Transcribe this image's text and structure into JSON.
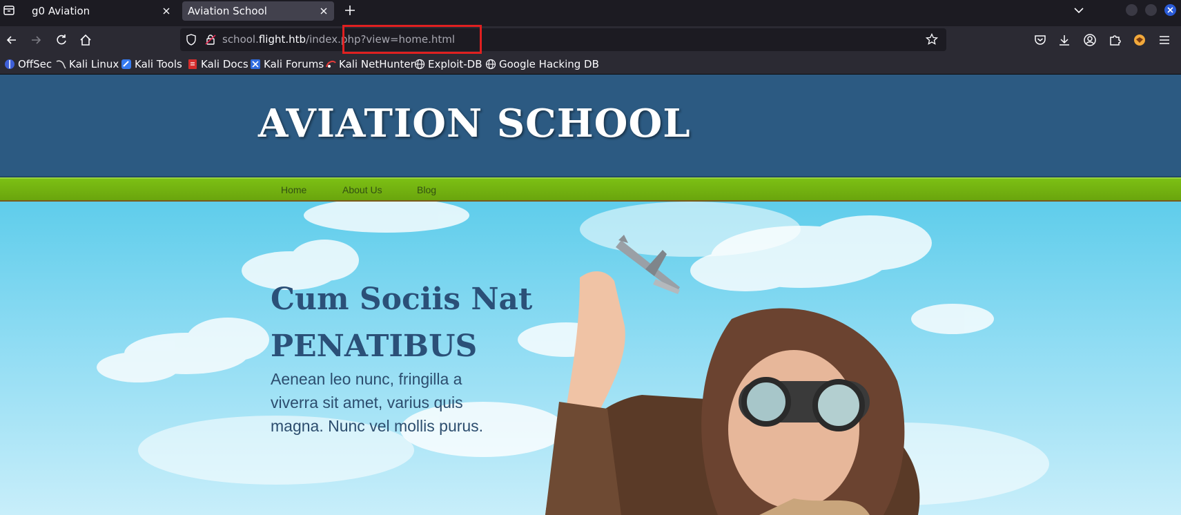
{
  "browser": {
    "tabs": [
      {
        "title": "g0 Aviation"
      },
      {
        "title": "Aviation School"
      }
    ],
    "url": {
      "host_prefix": "school.",
      "host_domain": "flight.htb",
      "path": "/index.php?view=home.html"
    },
    "bookmarks": [
      {
        "label": "OffSec",
        "icon": "offsec-icon"
      },
      {
        "label": "Kali Linux",
        "icon": "kali-dragon-icon"
      },
      {
        "label": "Kali Tools",
        "icon": "kali-tools-icon"
      },
      {
        "label": "Kali Docs",
        "icon": "kali-docs-icon"
      },
      {
        "label": "Kali Forums",
        "icon": "kali-forums-icon"
      },
      {
        "label": "Kali NetHunter",
        "icon": "nethunter-icon"
      },
      {
        "label": "Exploit-DB",
        "icon": "globe-icon"
      },
      {
        "label": "Google Hacking DB",
        "icon": "globe-icon"
      }
    ]
  },
  "site": {
    "title": "AVIATION SCHOOL",
    "nav": [
      "Home",
      "About Us",
      "Blog"
    ],
    "hero": {
      "heading_line1": "Cum Sociis Nat",
      "heading_line2": "PENATIBUS",
      "body": "Aenean leo nunc, fringilla a viverra sit amet, varius quis magna. Nunc vel mollis purus."
    }
  },
  "colors": {
    "header_blue": "#2c5a82",
    "nav_green": "#7cbf14",
    "url_highlight": "#e02020"
  }
}
